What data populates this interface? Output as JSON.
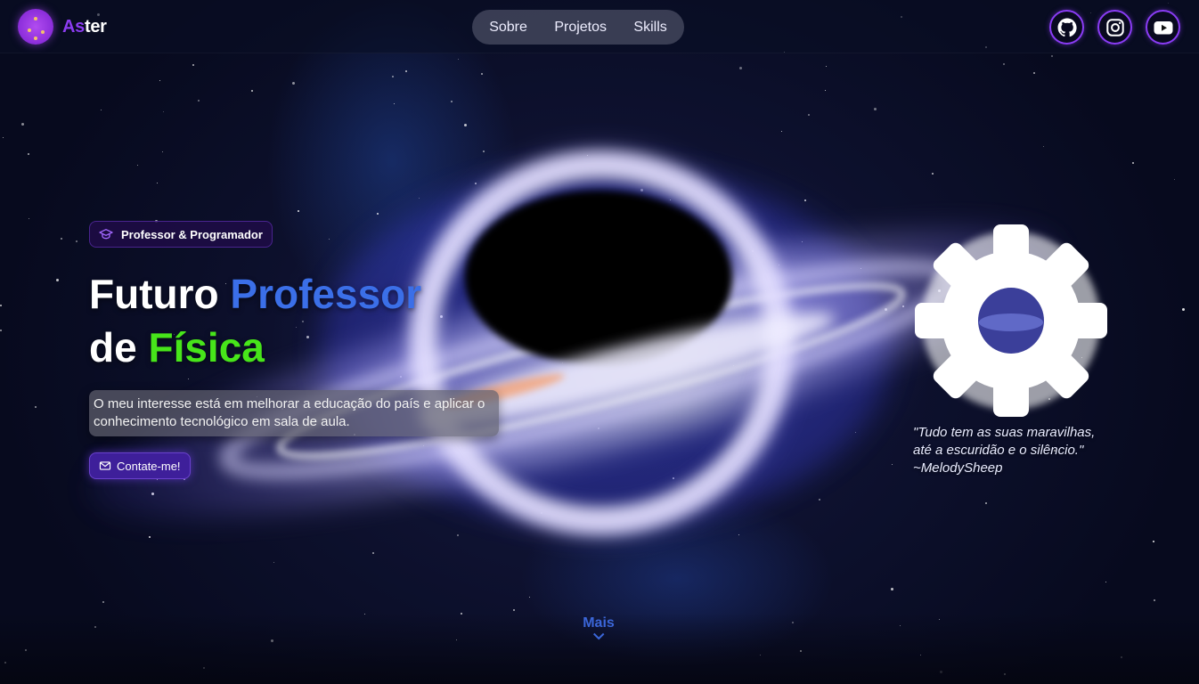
{
  "brand": {
    "name_part1": "As",
    "name_part2": "ter"
  },
  "nav": {
    "items": [
      {
        "label": "Sobre"
      },
      {
        "label": "Projetos"
      },
      {
        "label": "Skills"
      }
    ]
  },
  "socials": [
    {
      "icon": "github-icon"
    },
    {
      "icon": "instagram-icon"
    },
    {
      "icon": "youtube-icon"
    }
  ],
  "hero": {
    "badge": "Professor & Programador",
    "title_line1_white": "Futuro ",
    "title_line1_blue": "Professor",
    "title_line2_white": "de ",
    "title_line2_green": "Física",
    "description": "O meu interesse está em melhorar a educação do país e aplicar o conhecimento tecnológico em sala de aula.",
    "contact_button": "Contate-me!"
  },
  "quote": {
    "line1": "\"Tudo tem as suas maravilhas,",
    "line2": "até a escuridão e o silêncio.\"",
    "author": "~MelodySheep"
  },
  "more": {
    "label": "Mais"
  },
  "colors": {
    "accent_purple": "#8a3cf5",
    "title_blue": "#3b6fe8",
    "title_green": "#47e51a",
    "more_blue": "#3b66d8"
  }
}
